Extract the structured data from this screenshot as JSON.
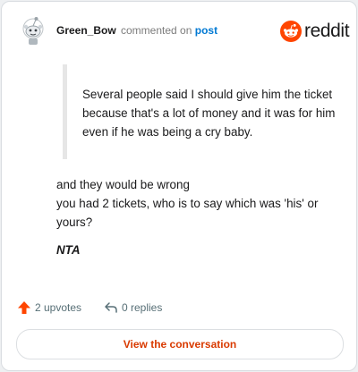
{
  "header": {
    "username": "Green_Bow",
    "action_text": "commented on",
    "post_link": "post",
    "brand_name": "reddit"
  },
  "quote": {
    "text": "Several people said I should give him the ticket because that's a lot of money and it was for him even if he was being a cry baby."
  },
  "comment": {
    "line1": "and they would be wrong",
    "line2": "you had 2 tickets, who is to say which was 'his' or yours?",
    "verdict": "NTA"
  },
  "footer": {
    "upvotes_label": "2 upvotes",
    "replies_label": "0 replies"
  },
  "button": {
    "label": "View the conversation"
  },
  "colors": {
    "brand": "#ff4500",
    "link": "#0079d3",
    "button_text": "#d93a00"
  },
  "icons": {
    "avatar": "snoo-avatar-icon",
    "brand": "reddit-logo-icon",
    "upvote": "upvote-arrow-icon",
    "reply": "reply-arrow-icon"
  }
}
